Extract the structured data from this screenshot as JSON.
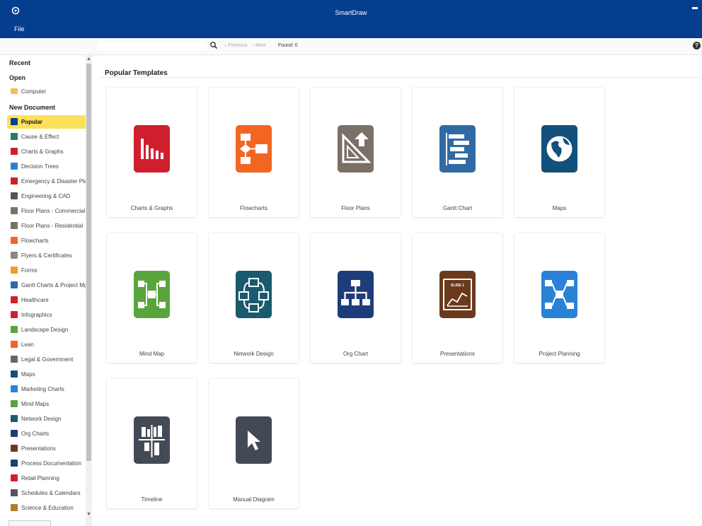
{
  "window": {
    "title": "SmartDraw"
  },
  "menu": {
    "file": "File"
  },
  "search": {
    "placeholder": "",
    "prev": "‹ Previous",
    "next": "› Next",
    "found": "Found: 0"
  },
  "sidebar": {
    "recent": "Recent",
    "open": "Open",
    "computer": "Computer",
    "new_document": "New Document",
    "items": [
      {
        "label": "Popular",
        "color": "#063e8e"
      },
      {
        "label": "Cause & Effect",
        "color": "#2a7a68"
      },
      {
        "label": "Charts & Graphs",
        "color": "#d01f2c"
      },
      {
        "label": "Decision Trees",
        "color": "#2a82d6"
      },
      {
        "label": "Emergency & Disaster Pla...",
        "color": "#d01f2c"
      },
      {
        "label": "Engineering & CAD",
        "color": "#555555"
      },
      {
        "label": "Floor Plans - Commercial",
        "color": "#7a7066"
      },
      {
        "label": "Floor Plans - Residential",
        "color": "#7a7066"
      },
      {
        "label": "Flowcharts",
        "color": "#f26522"
      },
      {
        "label": "Flyers & Certificates",
        "color": "#888888"
      },
      {
        "label": "Forms",
        "color": "#f59a23"
      },
      {
        "label": "Gantt Charts & Project Mgt",
        "color": "#2f6aa3"
      },
      {
        "label": "Healthcare",
        "color": "#d01f2c"
      },
      {
        "label": "Infographics",
        "color": "#d01f2c"
      },
      {
        "label": "Landscape Design",
        "color": "#5aa43d"
      },
      {
        "label": "Lean",
        "color": "#f26522"
      },
      {
        "label": "Legal & Government",
        "color": "#666666"
      },
      {
        "label": "Maps",
        "color": "#14507c"
      },
      {
        "label": "Marketing Charts",
        "color": "#2a82d6"
      },
      {
        "label": "Mind Maps",
        "color": "#5aa43d"
      },
      {
        "label": "Network Design",
        "color": "#1a5a6e"
      },
      {
        "label": "Org Charts",
        "color": "#1d3d7a"
      },
      {
        "label": "Presentations",
        "color": "#6b3a1d"
      },
      {
        "label": "Process Documentation",
        "color": "#1d3d7a"
      },
      {
        "label": "Retail Planning",
        "color": "#d01f2c"
      },
      {
        "label": "Schedules & Calendars",
        "color": "#555555"
      },
      {
        "label": "Science & Education",
        "color": "#b07b2a"
      }
    ]
  },
  "main": {
    "section_title": "Popular Templates",
    "templates": [
      {
        "label": "Charts & Graphs",
        "icon": "bar-chart-icon",
        "color": "#d01f2c"
      },
      {
        "label": "Flowcharts",
        "icon": "flowchart-icon",
        "color": "#f26522"
      },
      {
        "label": "Floor Plans",
        "icon": "floor-plan-icon",
        "color": "#7a7066"
      },
      {
        "label": "Gantt Chart",
        "icon": "gantt-icon",
        "color": "#2f6aa3"
      },
      {
        "label": "Maps",
        "icon": "globe-icon",
        "color": "#14507c"
      },
      {
        "label": "Mind Map",
        "icon": "mind-map-icon",
        "color": "#5aa43d"
      },
      {
        "label": "Network Design",
        "icon": "network-icon",
        "color": "#1a5a6e"
      },
      {
        "label": "Org Chart",
        "icon": "org-chart-icon",
        "color": "#1d3d7a"
      },
      {
        "label": "Presentations",
        "icon": "slide-icon",
        "color": "#6b3a1d"
      },
      {
        "label": "Project Planning",
        "icon": "project-planning-icon",
        "color": "#2a82d6"
      },
      {
        "label": "Timeline",
        "icon": "timeline-icon",
        "color": "#444a55"
      },
      {
        "label": "Manual Diagram",
        "icon": "cursor-icon",
        "color": "#444a55"
      }
    ],
    "slide_text": "SLIDE 1"
  }
}
